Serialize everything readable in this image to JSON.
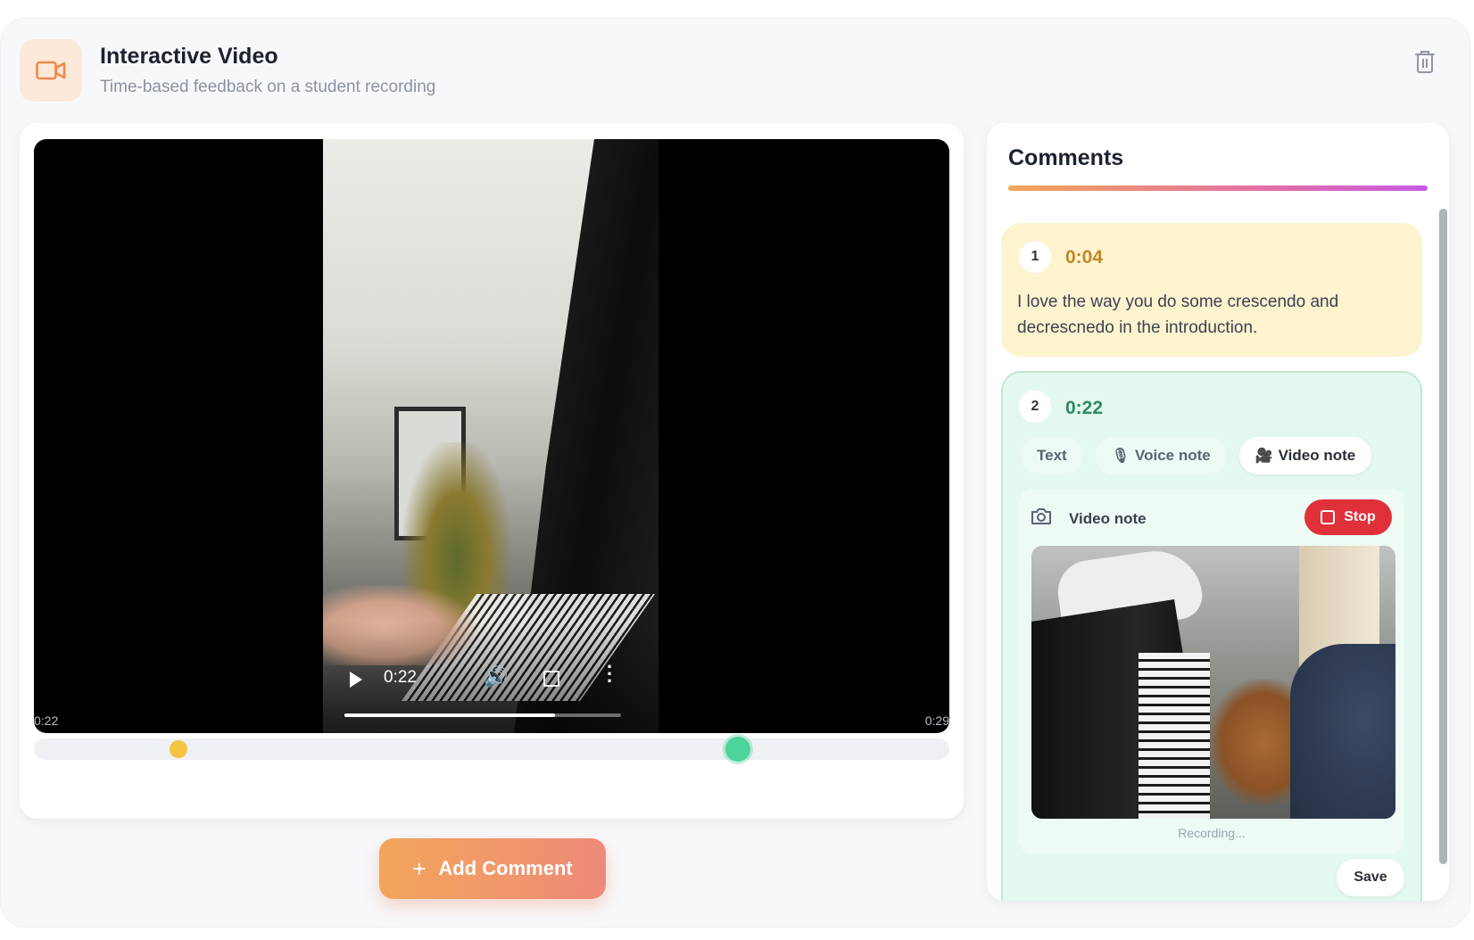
{
  "header": {
    "title": "Interactive Video",
    "subtitle": "Time-based feedback on a student recording",
    "accent_color": "#f08a4b"
  },
  "player": {
    "current_time": "0:22",
    "progress_fraction": 0.76
  },
  "timeline": {
    "start_label": "0:22",
    "end_label": "0:29",
    "markers": [
      {
        "position_fraction": 0.158,
        "color": "#f5c443"
      },
      {
        "position_fraction": 0.769,
        "color": "#4cd49a"
      }
    ]
  },
  "add_comment": {
    "label": "Add Comment"
  },
  "comments_panel": {
    "title": "Comments",
    "comments": [
      {
        "number": "1",
        "time": "0:04",
        "text": "I love the way you do some crescendo and decrescnedo in the introduction."
      },
      {
        "number": "2",
        "time": "0:22",
        "tabs": [
          {
            "label": "Text"
          },
          {
            "label": "Voice note"
          },
          {
            "label": "Video note"
          }
        ],
        "video_note": {
          "label": "Video note",
          "stop_label": "Stop",
          "status": "Recording..."
        },
        "save_label": "Save"
      }
    ]
  }
}
